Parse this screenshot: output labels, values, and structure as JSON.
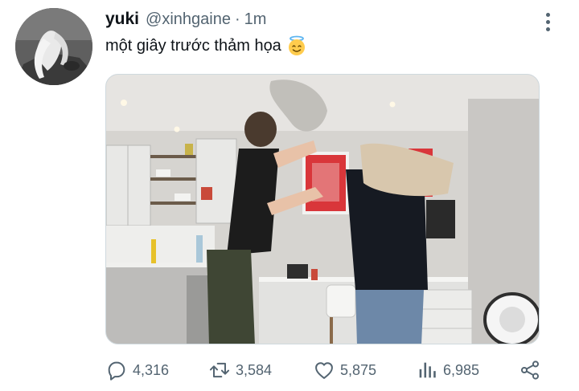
{
  "tweet": {
    "display_name": "yuki",
    "handle": "@xinhgaine",
    "separator": "·",
    "time": "1m",
    "text": "một giây trước thảm họa",
    "emoji": "smiling-face-with-halo"
  },
  "actions": {
    "reply_count": "4,316",
    "retweet_count": "3,584",
    "like_count": "5,875",
    "view_count": "6,985"
  },
  "colors": {
    "text_primary": "#0f1419",
    "text_secondary": "#536471",
    "border": "#cfd9de"
  }
}
